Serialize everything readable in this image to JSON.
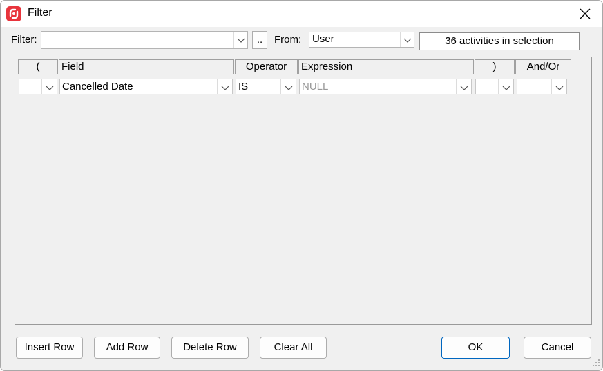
{
  "window": {
    "title": "Filter"
  },
  "filter_bar": {
    "filter_label": "Filter:",
    "filter_value": "",
    "browse_label": "..",
    "from_label": "From:",
    "from_value": "User",
    "selection_info": "36 activities in selection"
  },
  "grid": {
    "headers": [
      "(",
      "Field",
      "Operator",
      "Expression",
      ")",
      "And/Or"
    ],
    "rows": [
      {
        "open_paren": "",
        "field": "Cancelled Date",
        "operator": "IS",
        "expression": "NULL",
        "close_paren": "",
        "and_or": ""
      }
    ]
  },
  "buttons": {
    "insert_row": "Insert Row",
    "add_row": "Add Row",
    "delete_row": "Delete Row",
    "clear_all": "Clear All",
    "ok": "OK",
    "cancel": "Cancel"
  },
  "colors": {
    "accent": "#0067c0",
    "app_icon": "#e8343c",
    "disabled_text": "#999999"
  }
}
